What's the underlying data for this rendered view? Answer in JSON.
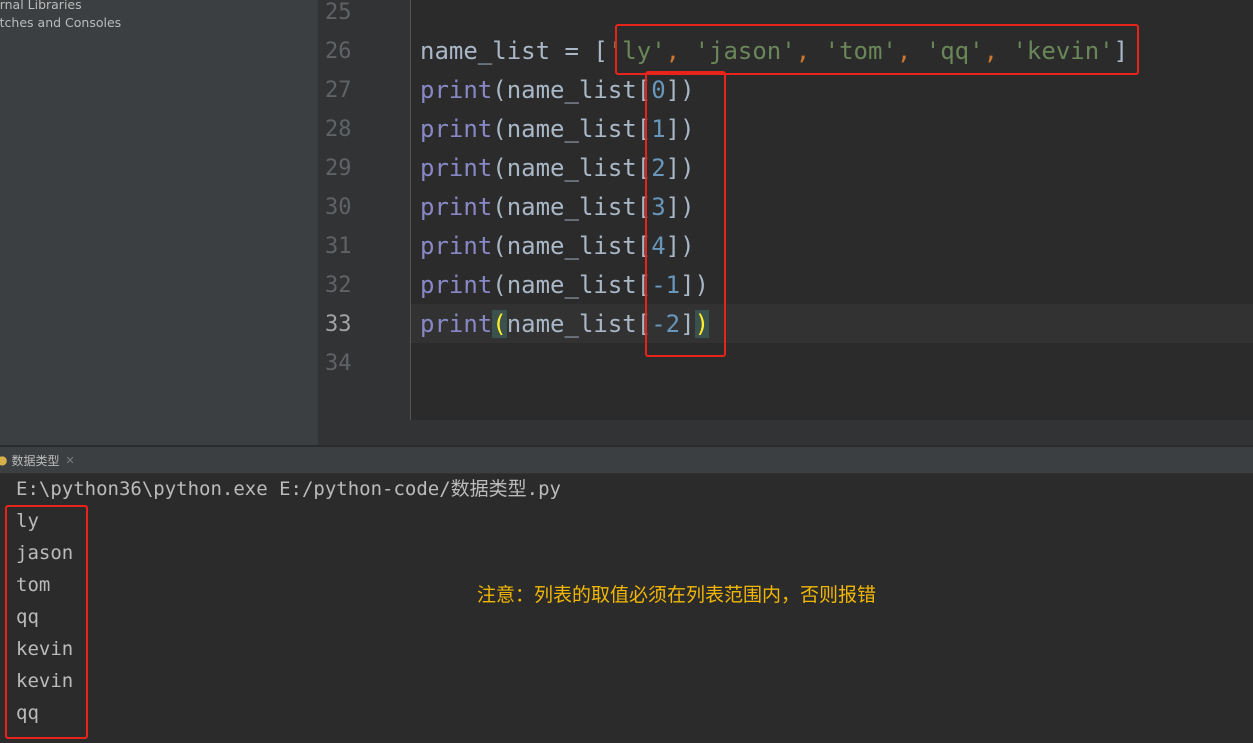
{
  "sidebar": {
    "items": [
      {
        "label": "ernal Libraries"
      },
      {
        "label": "atches and Consoles"
      }
    ]
  },
  "editor": {
    "line_numbers": [
      "25",
      "26",
      "27",
      "28",
      "29",
      "30",
      "31",
      "32",
      "33",
      "34"
    ],
    "current_line": "33",
    "lines": {
      "l26": {
        "var": "name_list",
        "eq": " = ",
        "open": "[",
        "s1": "'ly'",
        "s2": "'jason'",
        "s3": "'tom'",
        "s4": "'qq'",
        "s5": "'kevin'",
        "comma": ", ",
        "close": "]"
      },
      "print_kw": "print",
      "arg_name": "name_list",
      "indices": [
        "0",
        "1",
        "2",
        "3",
        "4",
        "-1",
        "-2"
      ]
    }
  },
  "run": {
    "tab_label": "数据类型",
    "command": "E:\\python36\\python.exe E:/python-code/数据类型.py",
    "output": [
      "ly",
      "jason",
      "tom",
      "qq",
      "kevin",
      "kevin",
      "qq"
    ],
    "note": "注意：列表的取值必须在列表范围内，否则报错"
  },
  "colors": {
    "annotation_box": "#e8241a",
    "note_text": "#f2b705",
    "string": "#6a8759",
    "number": "#6897bb",
    "builtin": "#8888c6"
  }
}
